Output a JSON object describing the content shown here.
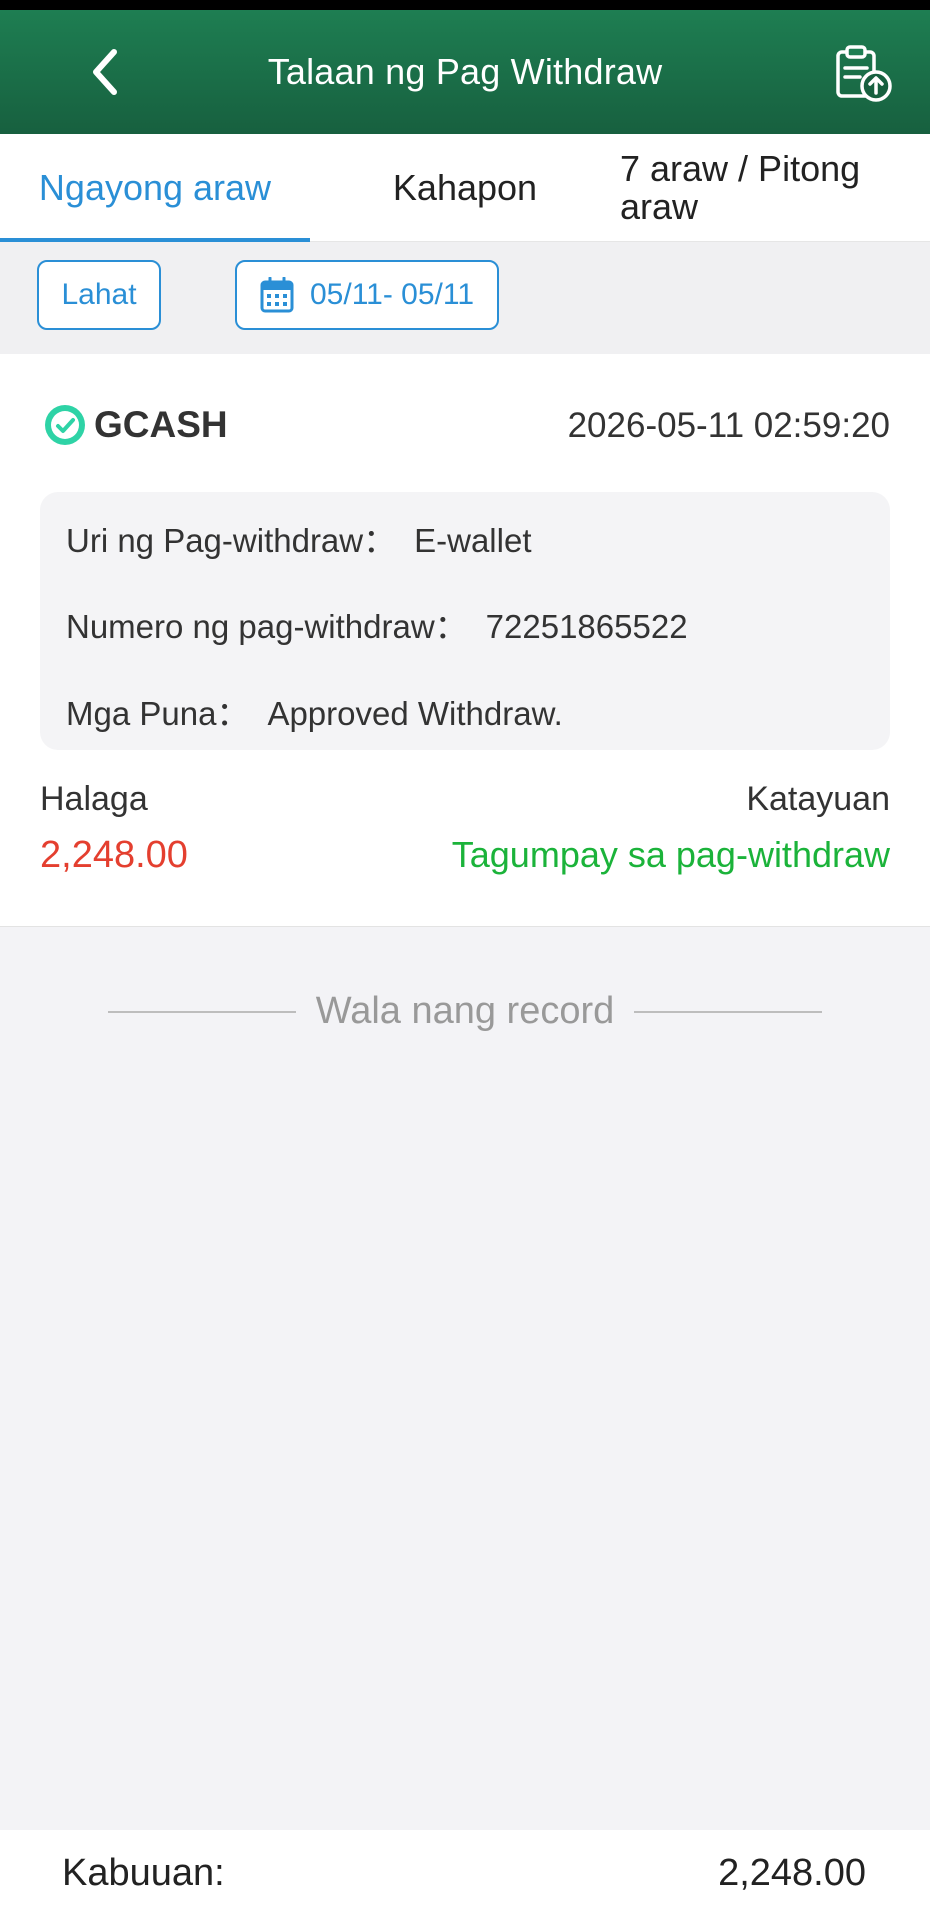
{
  "header": {
    "title": "Talaan ng Pag Withdraw"
  },
  "tabs": [
    {
      "label": "Ngayong araw"
    },
    {
      "label": "Kahapon"
    },
    {
      "label": "7 araw / Pitong araw"
    }
  ],
  "filters": {
    "all_label": "Lahat",
    "date_range": "05/11- 05/11"
  },
  "record": {
    "method": "GCASH",
    "datetime": "2026-05-11 02:59:20",
    "type_label": "Uri ng Pag-withdraw：",
    "type_value": "E-wallet",
    "number_label": "Numero ng pag-withdraw：",
    "number_value": "72251865522",
    "remarks_label": "Mga Puna：",
    "remarks_value": "Approved Withdraw.",
    "amount_label": "Halaga",
    "amount_value": "2,248.00",
    "status_label": "Katayuan",
    "status_value": "Tagumpay sa pag-withdraw"
  },
  "list_end_text": "Wala nang record",
  "footer": {
    "total_label": "Kabuuan:",
    "total_value": "2,248.00"
  },
  "icons": {
    "back": "chevron-left-icon",
    "records": "clipboard-upload-icon",
    "calendar": "calendar-icon",
    "gcash": "gcash-logo-icon"
  },
  "colors": {
    "header": "#1e7e52",
    "accent": "#2a8fd6",
    "amount": "#e43f2f",
    "success": "#1bb33a"
  }
}
